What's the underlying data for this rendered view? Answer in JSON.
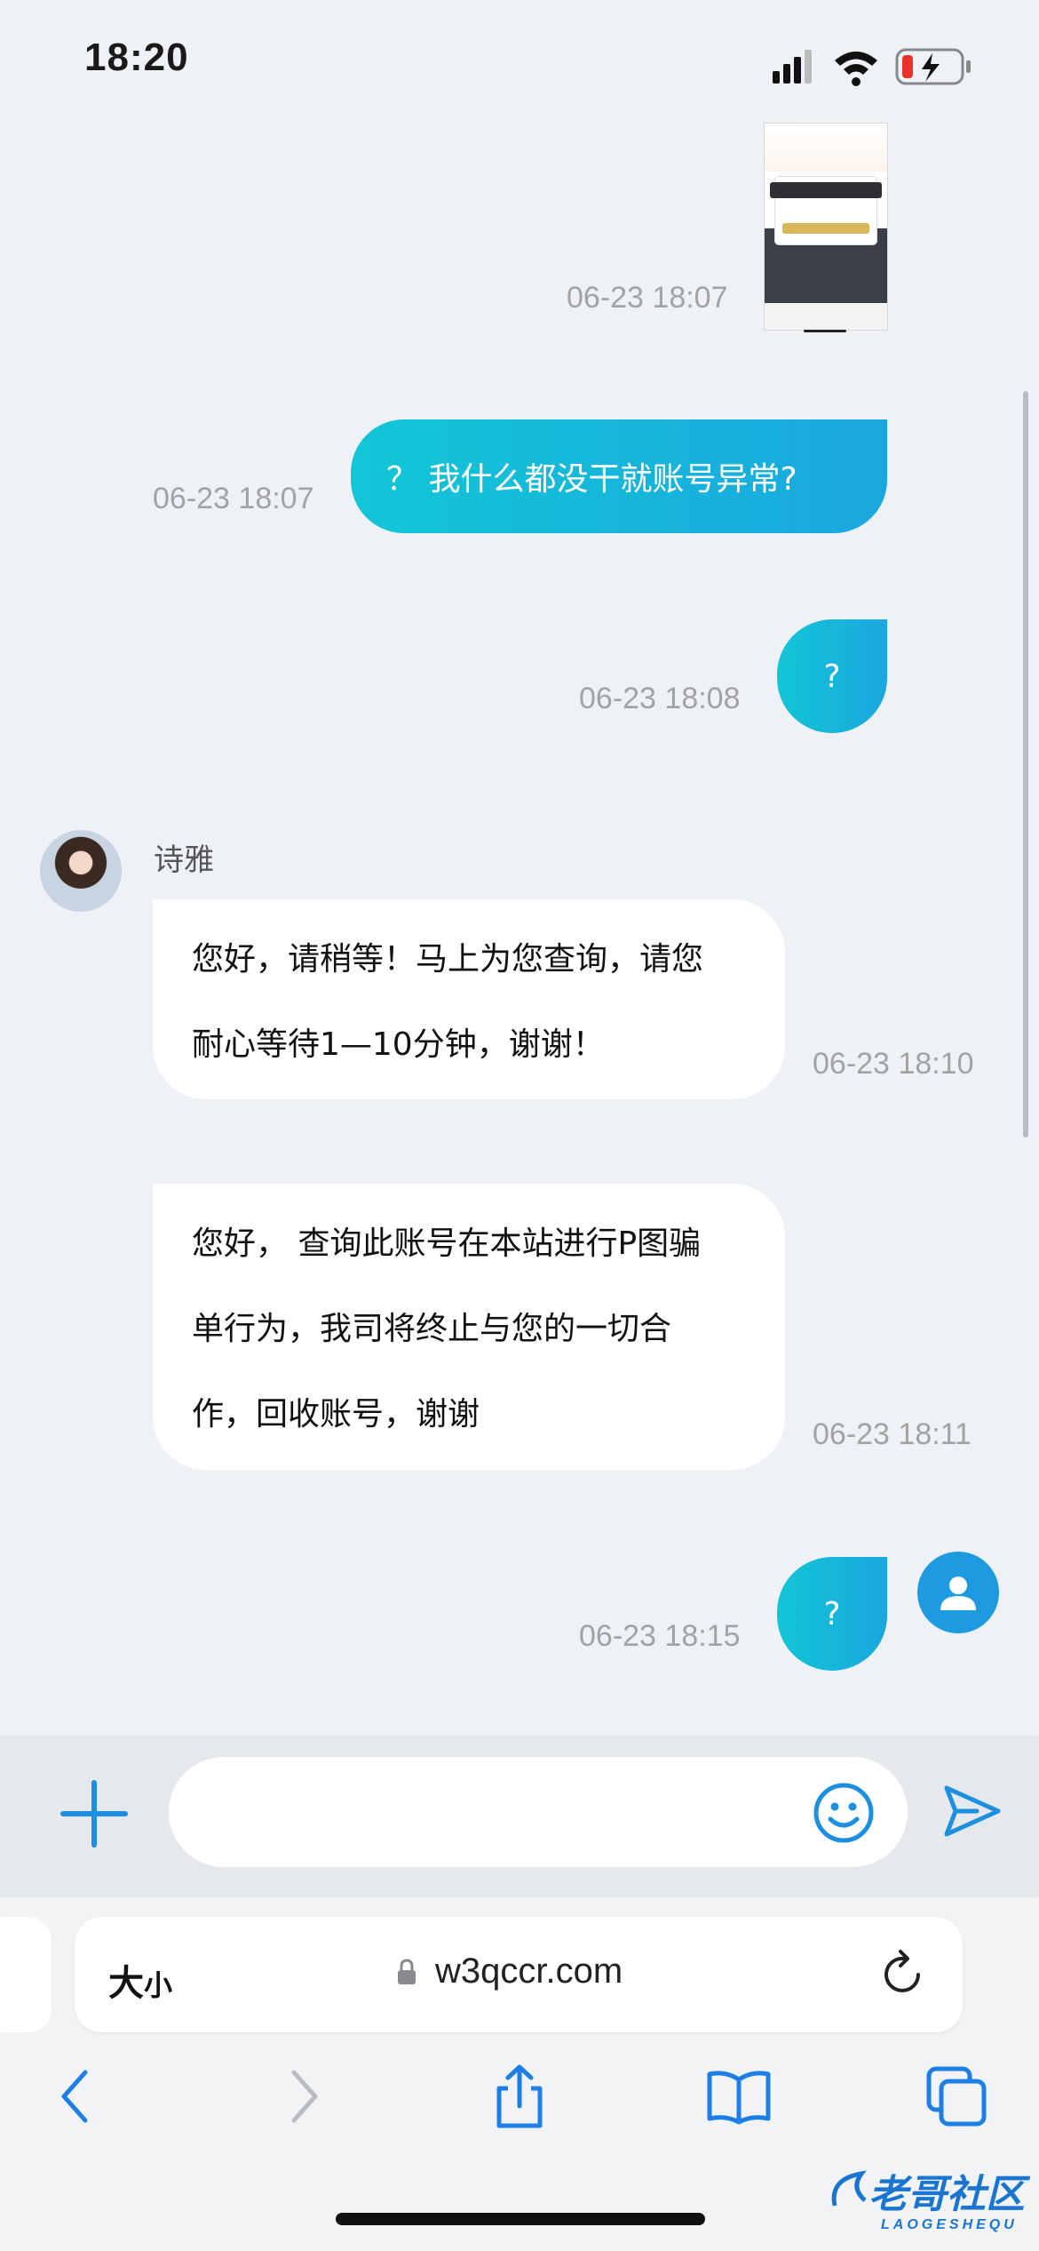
{
  "status_bar": {
    "time": "18:20"
  },
  "messages": [
    {
      "type": "image",
      "direction": "out",
      "time": "06-23 18:07"
    },
    {
      "type": "text",
      "direction": "out",
      "text": "？ 我什么都没干就账号异常?",
      "time": "06-23 18:07"
    },
    {
      "type": "text",
      "direction": "out",
      "text": "?",
      "time": "06-23 18:08"
    },
    {
      "type": "text",
      "direction": "in",
      "sender": "诗雅",
      "lines": [
        "您好，请稍等！马上为您查询，请您",
        "耐心等待1—10分钟，谢谢！"
      ],
      "time": "06-23 18:10"
    },
    {
      "type": "text",
      "direction": "in",
      "lines": [
        "您好， 查询此账号在本站进行P图骗",
        "单行为，我司将终止与您的一切合",
        "作，回收账号，谢谢"
      ],
      "time": "06-23 18:11"
    },
    {
      "type": "text",
      "direction": "out",
      "text": "?",
      "time": "06-23 18:15"
    }
  ],
  "composer": {
    "placeholder": ""
  },
  "safari": {
    "text_size_big": "大",
    "text_size_small": "小",
    "url": "w3qccr.com"
  },
  "watermark": {
    "title": "老哥社区",
    "subtitle": "LAOGESHEQU"
  },
  "colors": {
    "bubble_out_start": "#12c6d6",
    "bubble_out_end": "#1aa7df",
    "accent": "#1d8fe0"
  },
  "icons": [
    "signal-icon",
    "wifi-icon",
    "battery-icon",
    "plus-icon",
    "emoji-icon",
    "send-icon",
    "lock-icon",
    "reload-icon",
    "back-icon",
    "forward-icon",
    "share-icon",
    "bookmarks-icon",
    "tabs-icon"
  ]
}
